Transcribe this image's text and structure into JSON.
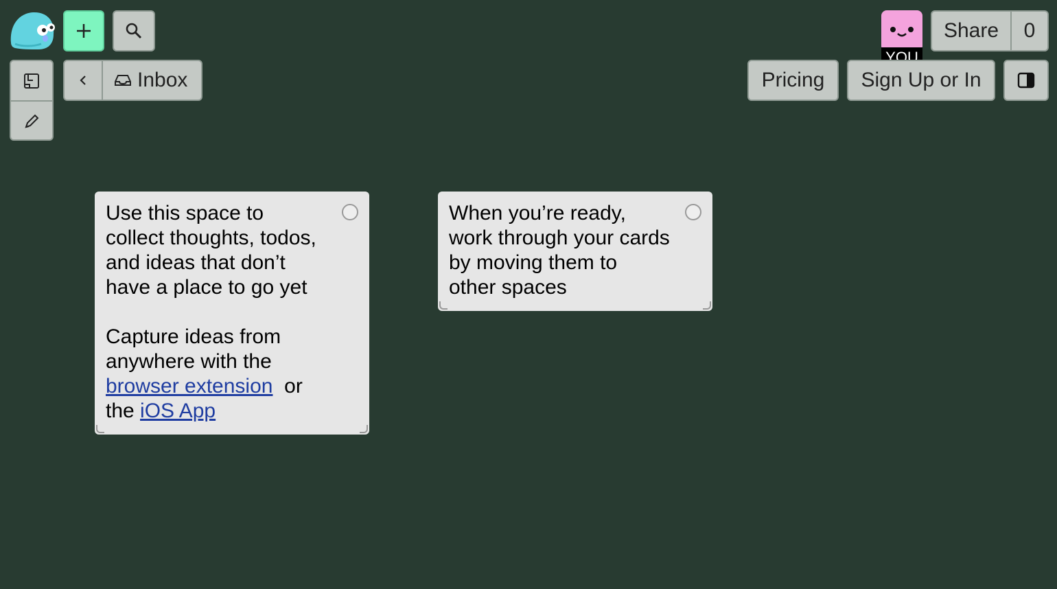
{
  "header": {
    "logo_icon": "kinopio-logo-icon",
    "add_icon": "plus-icon",
    "search_icon": "search-icon",
    "avatar_label": "YOU",
    "share_label": "Share",
    "share_count": "0",
    "pricing_label": "Pricing",
    "signup_label": "Sign Up or In",
    "sidebar_icon": "sidebar-toggle-icon"
  },
  "toolbar": {
    "card_mode_icon": "card-icon",
    "draw_icon": "pencil-icon"
  },
  "breadcrumb": {
    "back_icon": "chevron-left-icon",
    "space_icon": "inbox-icon",
    "space_name": "Inbox"
  },
  "cards": [
    {
      "text_main": "Use this space to\ncollect thoughts, todos,\nand ideas that don’t\nhave a place to go yet\n\nCapture ideas from\nanywhere with the\n",
      "link1": "browser extension",
      "mid": "  or\nthe ",
      "link2": "iOS App"
    },
    {
      "text_main": "When you’re ready,\nwork through your cards\nby moving them to\nother spaces"
    }
  ],
  "colors": {
    "background": "#283b31",
    "accent_add": "#7ef5bf",
    "avatar": "#f4a3dd",
    "card": "#e6e6e6",
    "link": "#1f3da1"
  }
}
